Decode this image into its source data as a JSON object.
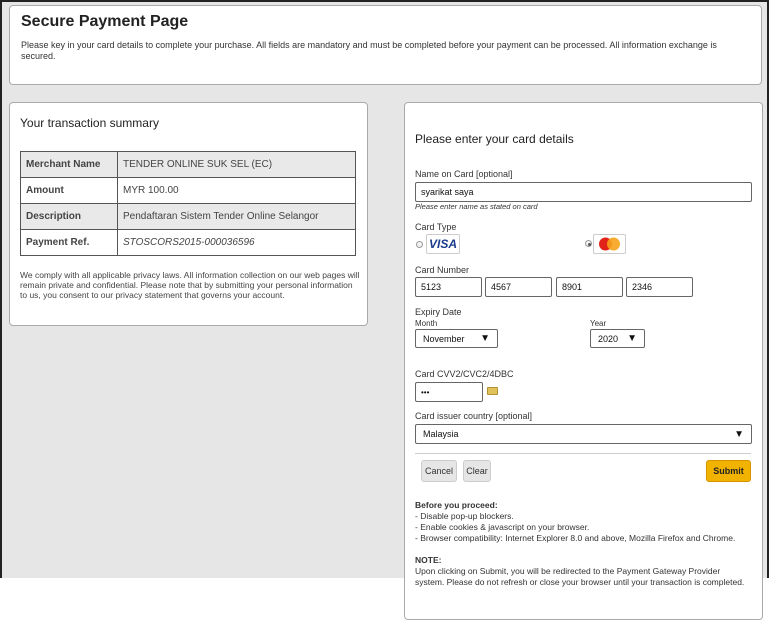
{
  "header": {
    "title": "Secure Payment Page",
    "description": "Please key in your card details to complete your purchase. All fields are mandatory and must be completed before your payment can be processed. All information exchange is secured."
  },
  "summary": {
    "title": "Your transaction summary",
    "rows": [
      {
        "label": "Merchant Name",
        "value": "TENDER ONLINE SUK SEL (EC)"
      },
      {
        "label": "Amount",
        "value": "MYR 100.00"
      },
      {
        "label": "Description",
        "value": "Pendaftaran Sistem Tender Online Selangor"
      },
      {
        "label": "Payment Ref.",
        "value": "STOSCORS2015-000036596"
      }
    ],
    "privacy": "We comply with all applicable privacy laws. All information collection on our web pages will remain private and confidential. Please note that by submitting your personal information to us, you consent to our privacy statement that governs your account."
  },
  "card_form": {
    "title": "Please enter your card details",
    "name_label": "Name on Card [optional]",
    "name_value": "syarikat saya",
    "name_hint": "Please enter name as stated on card",
    "type_label": "Card Type",
    "type_visa": "VISA",
    "type_selected": "mastercard",
    "number_label": "Card Number",
    "number_parts": [
      "5123",
      "4567",
      "8901",
      "2346"
    ],
    "expiry_label": "Expiry Date",
    "month_label": "Month",
    "month_value": "November",
    "year_label": "Year",
    "year_value": "2020",
    "cvv_label": "Card CVV2/CVC2/4DBC",
    "cvv_value": "•••",
    "country_label": "Card issuer country [optional]",
    "country_value": "Malaysia",
    "cancel_label": "Cancel",
    "clear_label": "Clear",
    "submit_label": "Submit",
    "before_title": "Before you proceed:",
    "before_items": [
      "- Disable pop-up blockers.",
      "- Enable cookies & javascript on your browser.",
      "- Browser compatibility: Internet Explorer 8.0 and above, Mozilla Firefox and Chrome."
    ],
    "note_title": "NOTE:",
    "note_text": "Upon clicking on Submit, you will be redirected to the Payment Gateway Provider system. Please do not refresh or close your browser until your transaction is completed."
  },
  "colors": {
    "submit": "#f2b300",
    "background": "#e6e6e6",
    "visa": "#1a3c8c"
  }
}
